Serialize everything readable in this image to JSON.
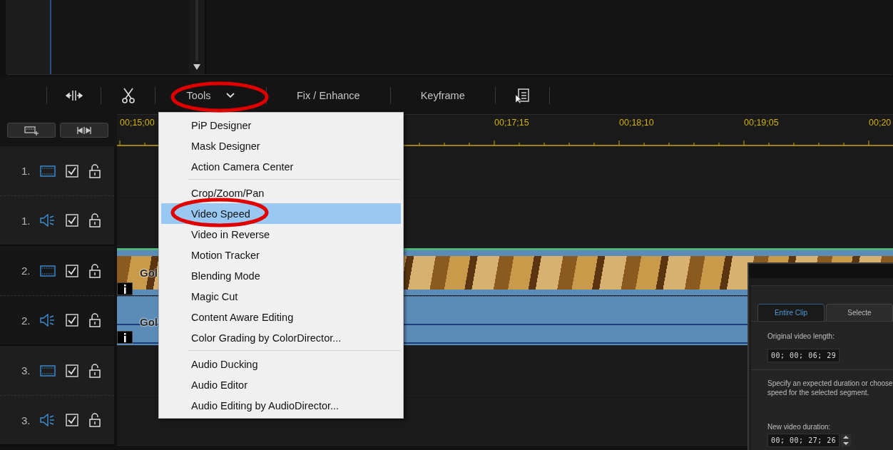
{
  "toolbar": [
    {
      "kind": "split"
    },
    {
      "kind": "cut"
    },
    {
      "kind": "dropdown",
      "label": "Tools",
      "expanded": true
    },
    {
      "kind": "button",
      "label": "Fix / Enhance"
    },
    {
      "kind": "button",
      "label": "Keyframe"
    },
    {
      "kind": "notes"
    }
  ],
  "tools_menu": [
    {
      "kind": "item",
      "label": "PiP Designer",
      "selected": false
    },
    {
      "kind": "item",
      "label": "Mask Designer",
      "selected": false
    },
    {
      "kind": "item",
      "label": "Action Camera Center",
      "selected": false
    },
    {
      "kind": "separator"
    },
    {
      "kind": "item",
      "label": "Crop/Zoom/Pan",
      "selected": false
    },
    {
      "kind": "item",
      "label": "Video Speed",
      "selected": true
    },
    {
      "kind": "item",
      "label": "Video in Reverse",
      "selected": false
    },
    {
      "kind": "item",
      "label": "Motion Tracker",
      "selected": false
    },
    {
      "kind": "item",
      "label": "Blending Mode",
      "selected": false
    },
    {
      "kind": "item",
      "label": "Magic Cut",
      "selected": false
    },
    {
      "kind": "item",
      "label": "Content Aware Editing",
      "selected": false
    },
    {
      "kind": "item",
      "label": "Color Grading by ColorDirector...",
      "selected": false
    },
    {
      "kind": "separator"
    },
    {
      "kind": "item",
      "label": "Audio Ducking",
      "selected": false
    },
    {
      "kind": "item",
      "label": "Audio Editor",
      "selected": false
    },
    {
      "kind": "item",
      "label": "Audio Editing by AudioDirector...",
      "selected": false
    }
  ],
  "ruler": {
    "labels": [
      "00;15;00",
      "00;17;15",
      "00;18;10",
      "00;19;05",
      "00;20"
    ]
  },
  "tracks": [
    {
      "number": "1.",
      "kind": "video",
      "checked": true,
      "locked": false
    },
    {
      "number": "1.",
      "kind": "audio",
      "checked": true,
      "locked": false
    },
    {
      "number": "2.",
      "kind": "video",
      "checked": true,
      "locked": false,
      "clip": {
        "title": "Gol"
      }
    },
    {
      "number": "2.",
      "kind": "audio",
      "checked": true,
      "locked": false,
      "clip": {
        "title": "Gol"
      }
    },
    {
      "number": "3.",
      "kind": "video",
      "checked": true,
      "locked": false
    },
    {
      "number": "3.",
      "kind": "audio",
      "checked": true,
      "locked": false
    }
  ],
  "speed_dialog": {
    "tabs": [
      {
        "label": "Entire Clip",
        "selected": true
      },
      {
        "label": "Selecte",
        "selected": false
      }
    ],
    "original_label": "Original video length:",
    "original_value": "00; 00; 06; 29",
    "hint_lines": [
      "Specify an expected duration or choose",
      "speed for the selected segment."
    ],
    "new_label": "New video duration:",
    "new_value": "00; 00; 27; 26"
  },
  "annotations": [
    {
      "kind": "circle"
    },
    {
      "kind": "circle"
    }
  ]
}
